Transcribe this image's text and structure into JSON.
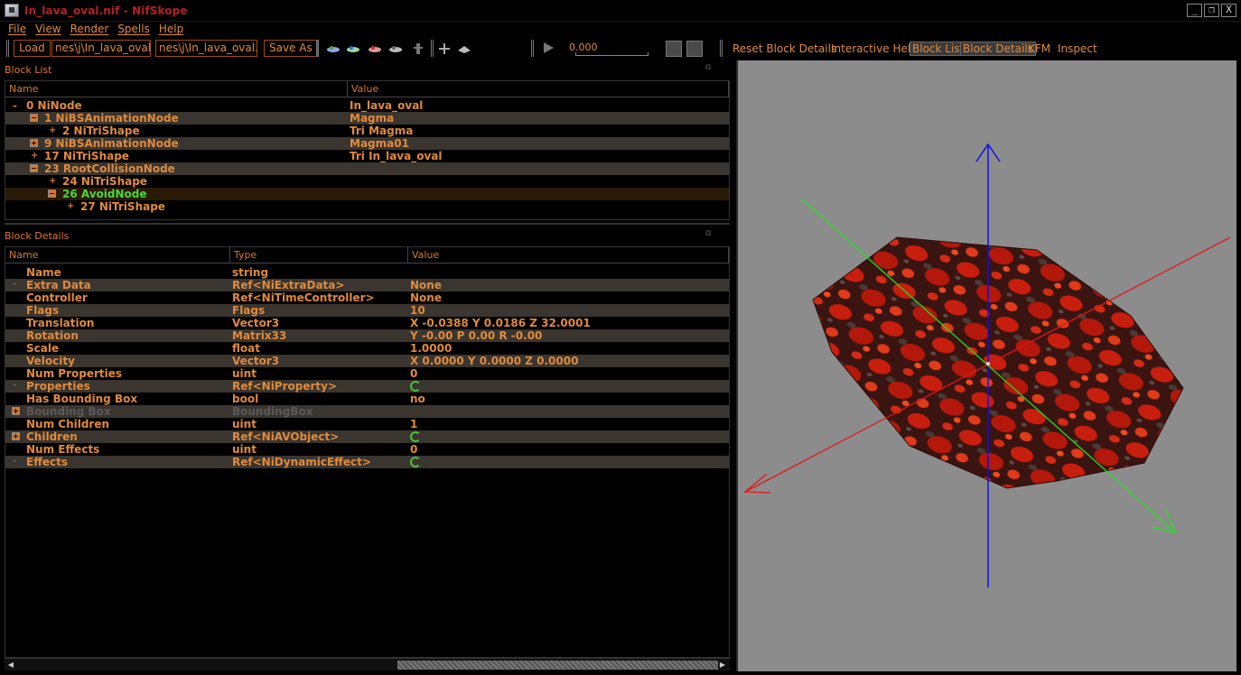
{
  "window": {
    "title": "In_lava_oval.nif - NifSkope",
    "minimize": "_",
    "restore": "❐",
    "close": "X"
  },
  "menu": {
    "items": [
      "File",
      "View",
      "Render",
      "Spells",
      "Help"
    ]
  },
  "toolbar": {
    "load_label": "Load",
    "load_path": "nes\\j\\In_lava_oval.nif",
    "save_path": "nes\\j\\In_lava_oval.nif",
    "save_label": "Save As",
    "time_value": "0.000",
    "reset_block_details": "Reset Block Details",
    "interactive_help": "Interactive Help",
    "block_list": "Block List",
    "block_details": "Block Details",
    "kfm": "KFM",
    "inspect": "Inspect"
  },
  "block_list": {
    "title": "Block List",
    "headers": {
      "name": "Name",
      "value": "Value"
    },
    "rows": [
      {
        "name": "0 NiNode",
        "value": "In_lava_oval"
      },
      {
        "name": "1 NiBSAnimationNode",
        "value": "Magma"
      },
      {
        "name": "2 NiTriShape",
        "value": "Tri Magma"
      },
      {
        "name": "9 NiBSAnimationNode",
        "value": "Magma01"
      },
      {
        "name": "17 NiTriShape",
        "value": "Tri In_lava_oval"
      },
      {
        "name": "23 RootCollisionNode",
        "value": ""
      },
      {
        "name": "24 NiTriShape",
        "value": ""
      },
      {
        "name": "26 AvoidNode",
        "value": ""
      },
      {
        "name": "27 NiTriShape",
        "value": ""
      }
    ]
  },
  "block_details": {
    "title": "Block Details",
    "headers": {
      "name": "Name",
      "type": "Type",
      "value": "Value"
    },
    "rows": [
      {
        "name": "Name",
        "type": "string",
        "value": ""
      },
      {
        "name": "Extra Data",
        "type": "Ref<NiExtraData>",
        "value": "None"
      },
      {
        "name": "Controller",
        "type": "Ref<NiTimeController>",
        "value": "None"
      },
      {
        "name": "Flags",
        "type": "Flags",
        "value": "10"
      },
      {
        "name": "Translation",
        "type": "Vector3",
        "value": "X -0.0388 Y 0.0186 Z 32.0001"
      },
      {
        "name": "Rotation",
        "type": "Matrix33",
        "value": "Y -0.00 P 0.00 R -0.00"
      },
      {
        "name": "Scale",
        "type": "float",
        "value": "1.0000"
      },
      {
        "name": "Velocity",
        "type": "Vector3",
        "value": "X 0.0000 Y 0.0000 Z 0.0000"
      },
      {
        "name": "Num Properties",
        "type": "uint",
        "value": "0"
      },
      {
        "name": "Properties",
        "type": "Ref<NiProperty>",
        "value": ""
      },
      {
        "name": "Has Bounding Box",
        "type": "bool",
        "value": "no"
      },
      {
        "name": "Bounding Box",
        "type": "BoundingBox",
        "value": ""
      },
      {
        "name": "Num Children",
        "type": "uint",
        "value": "1"
      },
      {
        "name": "Children",
        "type": "Ref<NiAVObject>",
        "value": ""
      },
      {
        "name": "Num Effects",
        "type": "uint",
        "value": "0"
      },
      {
        "name": "Effects",
        "type": "Ref<NiDynamicEffect>",
        "value": ""
      }
    ]
  },
  "colors": {
    "accent": "#e08a3c",
    "title_red": "#b52020",
    "selected_green": "#4cd63a",
    "viewport_bg": "#8c8c8c",
    "axis_x": "#e01818",
    "axis_y": "#20e020",
    "axis_z": "#1010e0"
  }
}
